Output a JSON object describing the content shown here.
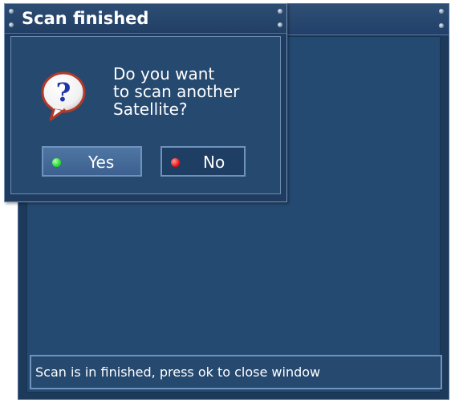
{
  "dialog": {
    "title": "Scan finished",
    "message_lines": [
      "Do you want",
      "to scan another",
      "Satellite?"
    ],
    "yes_label": "Yes",
    "no_label": "No",
    "yes_color": "#1edb2a",
    "no_color": "#ee1010",
    "icon": "question-speech-bubble-icon"
  },
  "status_bar": {
    "text": "Scan is in finished, press ok to close window"
  },
  "colors": {
    "panel": "#26496f",
    "border": "#6f93bd",
    "text": "#ffffff"
  }
}
